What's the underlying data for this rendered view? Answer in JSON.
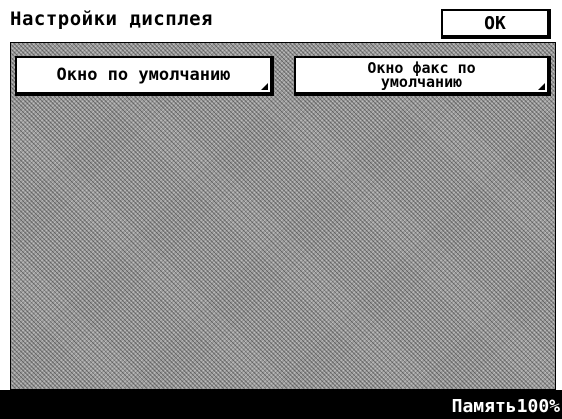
{
  "title": "Настройки дисплея",
  "ok_label": "OK",
  "options": {
    "default_window": "Окно по умолчанию",
    "fax_default_window": "Окно факс по\nумолчанию"
  },
  "status": {
    "memory": "Память100%"
  }
}
